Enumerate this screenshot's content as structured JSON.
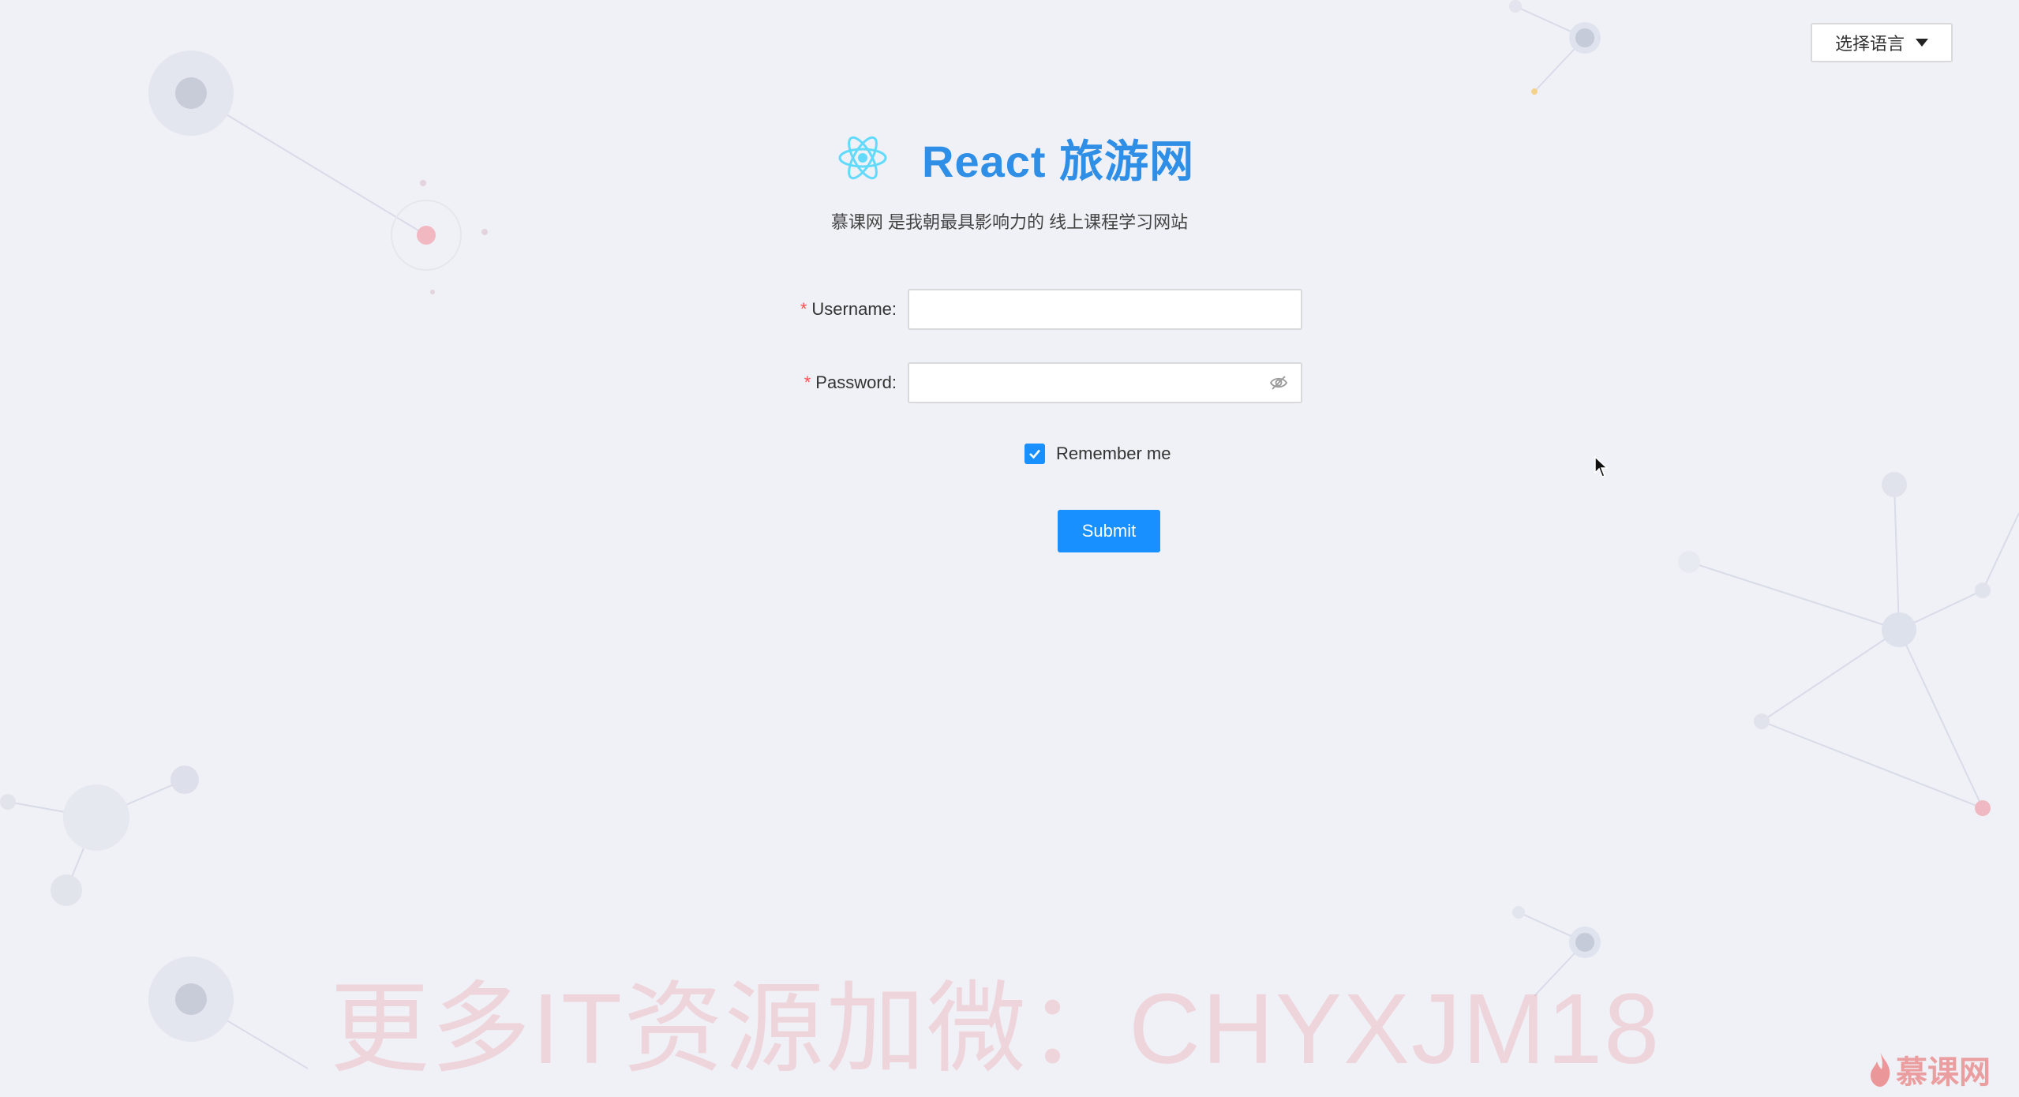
{
  "language_selector": {
    "label": "选择语言",
    "icon": "caret-down-icon"
  },
  "header": {
    "logo_icon": "react-atom-icon",
    "title": "React 旅游网",
    "subtitle": "慕课网 是我朝最具影响力的 线上课程学习网站"
  },
  "form": {
    "username": {
      "required_mark": "*",
      "label": "Username:",
      "value": "",
      "placeholder": ""
    },
    "password": {
      "required_mark": "*",
      "label": "Password:",
      "value": "",
      "placeholder": "",
      "toggle_icon": "eye-invisible-icon"
    },
    "remember": {
      "label": "Remember me",
      "checked": true
    },
    "submit_label": "Submit"
  },
  "watermark": {
    "text": "更多IT资源加微：CHYXJM18"
  },
  "corner_logo": {
    "text": "慕课网",
    "icon": "flame-icon"
  },
  "colors": {
    "background": "#f0f1f6",
    "brand": "#2f8ee5",
    "primary": "#1890ff",
    "required": "#ff4d4f",
    "react_logo": "#61dafb"
  }
}
